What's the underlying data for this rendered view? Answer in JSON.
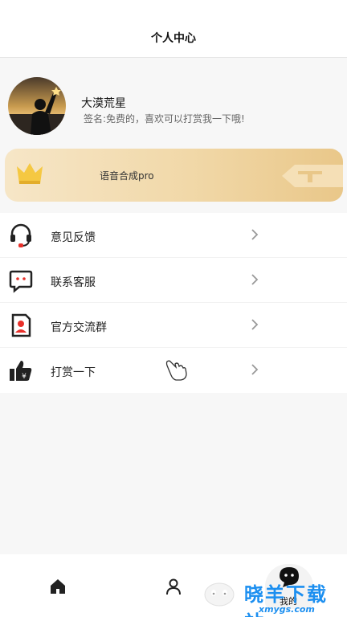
{
  "header": {
    "title": "个人中心"
  },
  "profile": {
    "nickname": "大漠荒星",
    "signature": "签名:免费的，喜欢可以打赏我一下哦!"
  },
  "vip_card": {
    "label": "语音合成pro",
    "crown_color": "#f5c842"
  },
  "menu": {
    "items": [
      {
        "label": "意见反馈",
        "icon": "headset-icon"
      },
      {
        "label": "联系客服",
        "icon": "chat-bubble-icon"
      },
      {
        "label": "官方交流群",
        "icon": "contact-card-icon"
      },
      {
        "label": "打赏一下",
        "icon": "thumbs-up-yuan-icon"
      }
    ]
  },
  "tabbar": {
    "mine_label": "我的"
  },
  "watermark": {
    "text": "晓羊下载站",
    "url": "xmygs.com"
  },
  "colors": {
    "accent_red": "#e8302a",
    "watermark_blue": "#1c8ff0"
  }
}
